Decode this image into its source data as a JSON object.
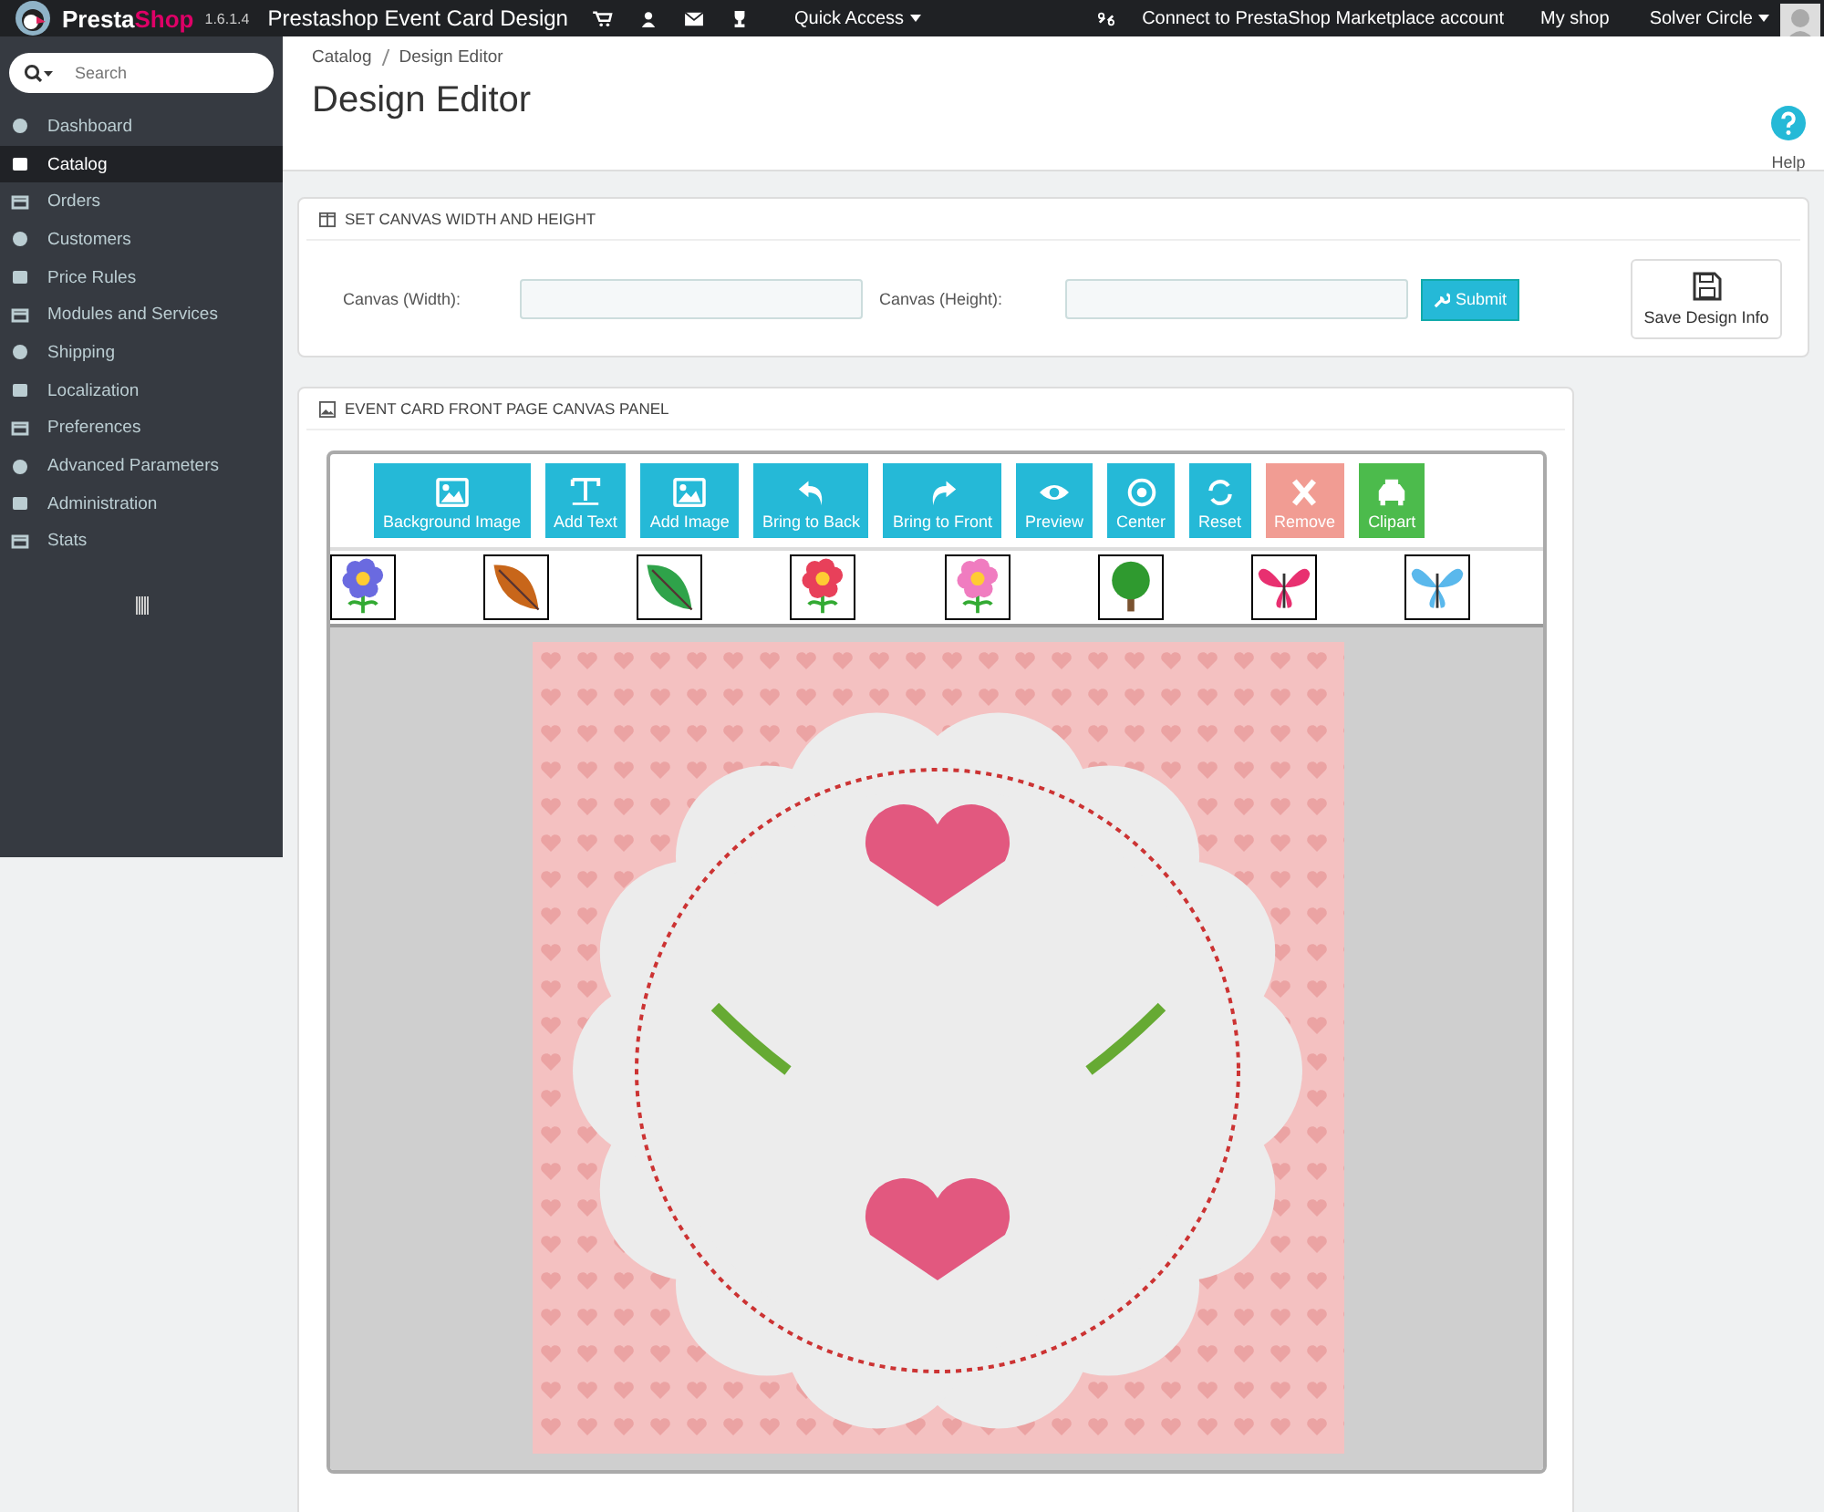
{
  "topbar": {
    "brand_prefix": "Presta",
    "brand_suffix": "Shop",
    "version": "1.6.1.4",
    "title": "Prestashop Event Card Design",
    "quick_access": "Quick Access",
    "marketplace": "Connect to PrestaShop Marketplace account",
    "my_shop": "My shop",
    "user": "Solver Circle"
  },
  "sidebar": {
    "search": {
      "placeholder": "Search"
    },
    "items": [
      {
        "label": "Dashboard",
        "selected": false
      },
      {
        "label": "Catalog",
        "selected": true
      },
      {
        "label": "Orders",
        "selected": false
      },
      {
        "label": "Customers",
        "selected": false
      },
      {
        "label": "Price Rules",
        "selected": false
      },
      {
        "label": "Modules and Services",
        "selected": false
      },
      {
        "label": "Shipping",
        "selected": false
      },
      {
        "label": "Localization",
        "selected": false
      },
      {
        "label": "Preferences",
        "selected": false
      },
      {
        "label": "Advanced Parameters",
        "selected": false
      },
      {
        "label": "Administration",
        "selected": false
      },
      {
        "label": "Stats",
        "selected": false
      }
    ]
  },
  "header": {
    "breadcrumb": [
      "Catalog",
      "Design Editor"
    ],
    "title": "Design Editor",
    "help": "Help"
  },
  "canvas_size_panel": {
    "title": "SET CANVAS WIDTH AND HEIGHT",
    "width_label": "Canvas (Width):",
    "height_label": "Canvas (Height):",
    "submit": "Submit",
    "save": "Save Design Info"
  },
  "canvas_panel": {
    "title": "EVENT CARD FRONT PAGE CANVAS PANEL",
    "buttons": [
      {
        "label": "Background Image",
        "kind": "info",
        "disabled": false
      },
      {
        "label": "Add Text",
        "kind": "info",
        "disabled": false
      },
      {
        "label": "Add Image",
        "kind": "info",
        "disabled": false
      },
      {
        "label": "Bring to Back",
        "kind": "info",
        "disabled": false
      },
      {
        "label": "Bring to Front",
        "kind": "info",
        "disabled": false
      },
      {
        "label": "Preview",
        "kind": "info",
        "disabled": false
      },
      {
        "label": "Center",
        "kind": "info",
        "disabled": false
      },
      {
        "label": "Reset",
        "kind": "info",
        "disabled": false
      },
      {
        "label": "Remove",
        "kind": "danger",
        "disabled": true
      },
      {
        "label": "Clipart",
        "kind": "success",
        "disabled": false
      }
    ]
  }
}
